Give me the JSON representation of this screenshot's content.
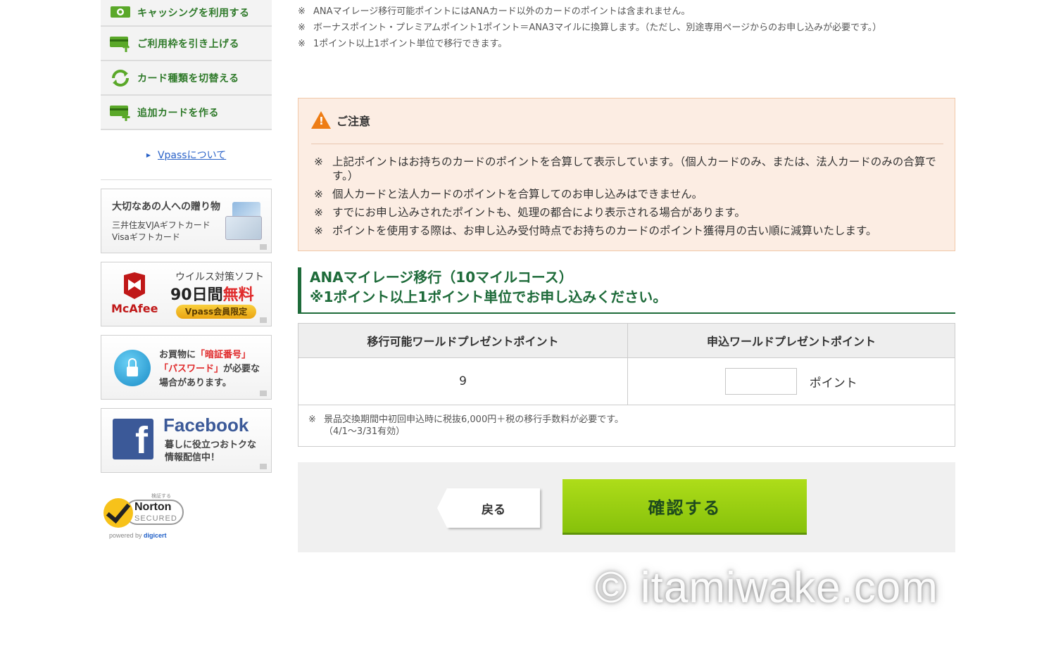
{
  "sidebar": {
    "menu": [
      {
        "label": "キャッシングを利用する",
        "icon": "cash-icon"
      },
      {
        "label": "ご利用枠を引き上げる",
        "icon": "card-up-icon"
      },
      {
        "label": "カード種類を切替える",
        "icon": "switch-icon"
      },
      {
        "label": "追加カードを作る",
        "icon": "card-add-icon"
      }
    ],
    "vpass_link": "Vpassについて",
    "banners": {
      "gift": {
        "line1": "大切なあの人への贈り物",
        "line2": "三井住友VJAギフトカード",
        "line3": "Visaギフトカード"
      },
      "mcafee": {
        "brand": "McAfee",
        "line1": "ウイルス対策ソフト",
        "days": "90日間",
        "free": "無料",
        "pill": "Vpass会員限定"
      },
      "security": {
        "l1a": "お買物に",
        "l1b": "「暗証番号」",
        "l2a": "「パスワード」",
        "l2b": "が必要な",
        "l3": "場合があります。"
      },
      "facebook": {
        "logo": "f",
        "title": "Facebook",
        "line1": "暮しに役立つおトクな",
        "line2": "情報配信中！"
      }
    },
    "norton": {
      "top": "検証する",
      "name": "Norton",
      "secured": "SECURED",
      "powered": "powered by",
      "digicert": "digicert"
    }
  },
  "notes": [
    "ANAマイレージ移行可能ポイントにはANAカード以外のカードのポイントは含まれません。",
    "ボーナスポイント・プレミアムポイント1ポイント＝ANA3マイルに換算します。（ただし、別途専用ページからのお申し込みが必要です。）",
    "1ポイント以上1ポイント単位で移行できます。"
  ],
  "note_mark": "※",
  "caution": {
    "title": "ご注意",
    "items": [
      "上記ポイントはお持ちのカードのポイントを合算して表示しています。（個人カードのみ、または、法人カードのみの合算です。）",
      "個人カードと法人カードのポイントを合算してのお申し込みはできません。",
      "すでにお申し込みされたポイントも、処理の都合により表示される場合があります。",
      "ポイントを使用する際は、お申し込み受付時点でお持ちのカードのポイント獲得月の古い順に減算いたします。"
    ]
  },
  "section": {
    "line1": "ANAマイレージ移行（10マイルコース）",
    "line2": "※1ポイント以上1ポイント単位でお申し込みください。"
  },
  "table": {
    "col1": "移行可能ワールドプレゼントポイント",
    "col2": "申込ワールドプレゼントポイント",
    "available": "9",
    "input_value": "",
    "unit": "ポイント",
    "fee_line1": "景品交換期間中初回申込時に税抜6,000円＋税の移行手数料が必要です。",
    "fee_line2": "（4/1〜3/31有効）"
  },
  "buttons": {
    "back": "戻る",
    "confirm": "確認する"
  },
  "watermark": "© itamiwake.com",
  "colors": {
    "accent_green": "#2f7a2a",
    "heading_green": "#1e6b3a",
    "confirm_green": "#9bd114",
    "caution_bg": "#fcede3",
    "warning_orange": "#ee7d15"
  }
}
